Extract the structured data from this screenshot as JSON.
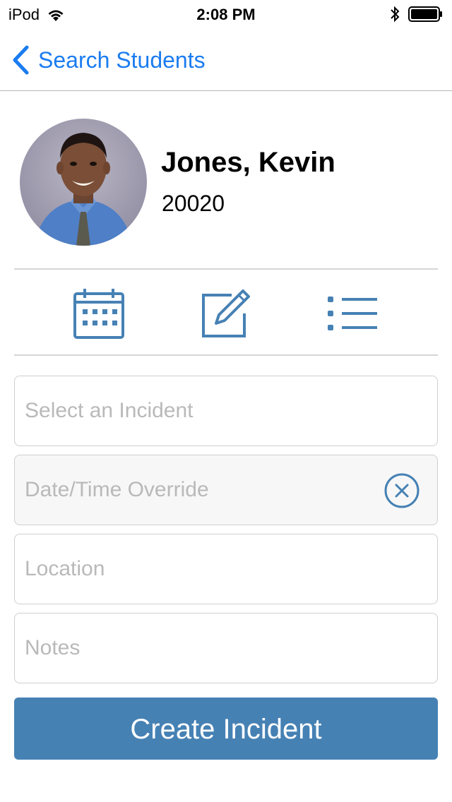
{
  "status_bar": {
    "carrier": "iPod",
    "time": "2:08 PM",
    "battery_level": 1.0,
    "icons": [
      "wifi-icon",
      "bluetooth-icon",
      "battery-icon"
    ]
  },
  "nav": {
    "back_label": "Search Students",
    "back_icon": "chevron-left-icon"
  },
  "student": {
    "name": "Jones, Kevin",
    "id": "20020"
  },
  "tabs": [
    {
      "icon": "calendar-icon"
    },
    {
      "icon": "edit-icon"
    },
    {
      "icon": "list-icon"
    }
  ],
  "form": {
    "incident": {
      "placeholder": "Select an Incident",
      "value": ""
    },
    "datetime": {
      "placeholder": "Date/Time Override",
      "value": "",
      "clear_icon": "clear-circle-icon"
    },
    "location": {
      "placeholder": "Location",
      "value": ""
    },
    "notes": {
      "placeholder": "Notes",
      "value": ""
    }
  },
  "create_button": {
    "label": "Create Incident"
  },
  "colors": {
    "link_blue": "#1b7cf0",
    "accent": "#4681b4"
  }
}
